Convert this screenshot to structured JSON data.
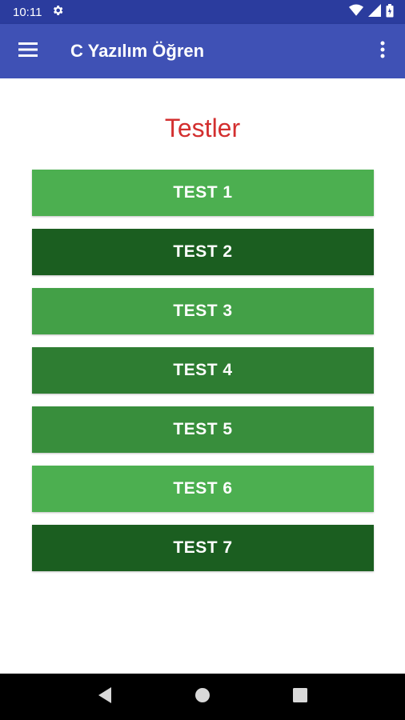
{
  "status_bar": {
    "time": "10:11",
    "icons": [
      "settings-icon",
      "wifi-icon",
      "signal-icon",
      "battery-icon"
    ]
  },
  "app_bar": {
    "title": "C Yazılım Öğren",
    "color": "#3f51b5",
    "left_icon": "hamburger-menu-icon",
    "right_icon": "more-vert-icon"
  },
  "main": {
    "title": "Testler",
    "title_color": "#d32f2f",
    "tests": [
      {
        "label": "TEST 1",
        "color": "#4caf50"
      },
      {
        "label": "TEST 2",
        "color": "#1b5e20"
      },
      {
        "label": "TEST 3",
        "color": "#43a047"
      },
      {
        "label": "TEST 4",
        "color": "#2e7d32"
      },
      {
        "label": "TEST 5",
        "color": "#388e3c"
      },
      {
        "label": "TEST 6",
        "color": "#4caf50"
      },
      {
        "label": "TEST 7",
        "color": "#1b5e20"
      }
    ]
  },
  "nav_bar": {
    "icons": [
      "back-icon",
      "home-icon",
      "recents-icon"
    ]
  }
}
